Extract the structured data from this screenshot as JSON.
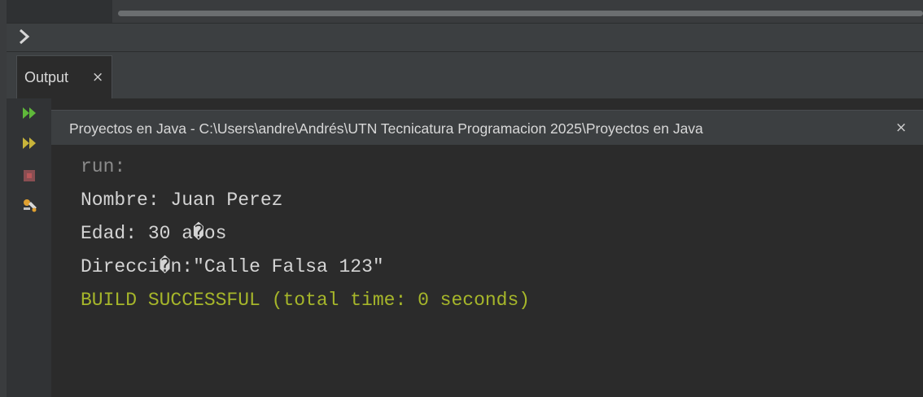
{
  "window": {
    "prompt_symbol": "›"
  },
  "tabs": {
    "output_label": "Output",
    "close_glyph": "×"
  },
  "run_tab": {
    "label": "Proyectos en Java - C:\\Users\\andre\\Andrés\\UTN Tecnicatura Programacion 2025\\Proyectos en Java",
    "close_glyph": "×"
  },
  "toolbar": {
    "icons": [
      "rerun-icon",
      "rerun-with-options-icon",
      "stop-icon",
      "settings-icon"
    ],
    "colors": {
      "rerun": "#5fb83a",
      "rerun_options": "#c8b43a",
      "stop": "#b8575a",
      "settings": "#e0a030"
    }
  },
  "console": {
    "lines": [
      {
        "text": "run:",
        "style": "gray"
      },
      {
        "text": "Nombre: Juan Perez",
        "style": "white"
      },
      {
        "text": "Edad: 30 a�os",
        "style": "white"
      },
      {
        "text": "Direcci�n:\"Calle Falsa 123\"",
        "style": "white"
      },
      {
        "text": "BUILD SUCCESSFUL (total time: 0 seconds)",
        "style": "green"
      }
    ]
  }
}
